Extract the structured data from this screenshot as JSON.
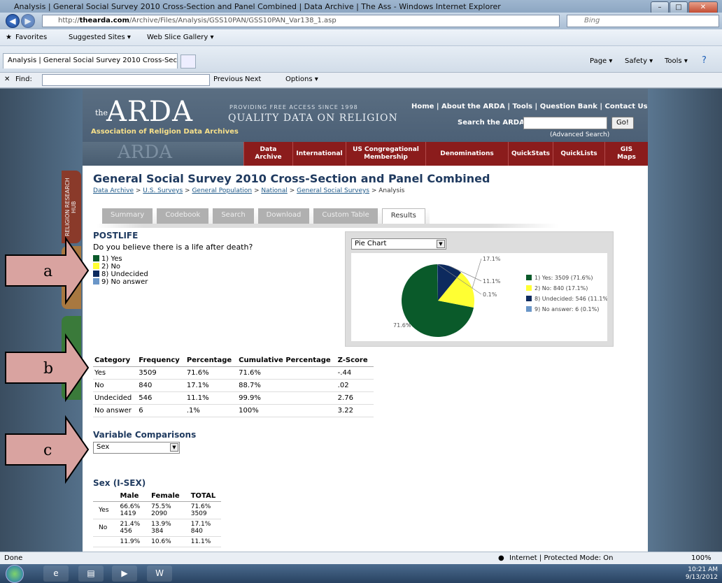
{
  "window": {
    "title": "Analysis | General Social Survey 2010 Cross-Section and Panel Combined | Data Archive | The Ass - Windows Internet Explorer",
    "url_prefix": "http://",
    "url_host": "thearda.com",
    "url_path": "/Archive/Files/Analysis/GSS10PAN/GSS10PAN_Var138_1.asp",
    "search_placeholder": "Bing",
    "favorites_label": "Favorites",
    "suggested_sites": "Suggested Sites ▾",
    "web_slice": "Web Slice Gallery ▾",
    "tab_label": "Analysis | General Social Survey 2010 Cross-Sectio...",
    "cmd_page": "Page ▾",
    "cmd_safety": "Safety ▾",
    "cmd_tools": "Tools ▾",
    "find_label": "Find:",
    "find_previous": "Previous",
    "find_next": "Next",
    "find_options": "Options ▾",
    "status_left": "Done",
    "status_zone": "Internet | Protected Mode: On",
    "zoom": "100%",
    "clock_time": "10:21 AM",
    "clock_date": "9/13/2012"
  },
  "site": {
    "logo_the": "the",
    "logo_main": "ARDA",
    "logo_sub": "Association of Religion Data Archives",
    "tagline_small": "PROVIDING FREE ACCESS SINCE 1998",
    "tagline_big": "QUALITY DATA ON RELIGION",
    "top_links": "Home | About the ARDA | Tools | Question Bank | Contact Us",
    "search_label": "Search the ARDA",
    "go_label": "Go!",
    "advanced_search": "(Advanced Search)",
    "nav": [
      "Data\nArchive",
      "International",
      "US Congregational\nMembership",
      "Denominations",
      "QuickStats",
      "QuickLists",
      "GIS\nMaps"
    ],
    "hub_label": "RELIGION RESEARCH HUB"
  },
  "page": {
    "title": "General Social Survey 2010 Cross-Section and Panel Combined",
    "crumbs": [
      "Data Archive",
      "U.S. Surveys",
      "General Population",
      "National",
      "General Social Surveys"
    ],
    "crumb_last": "Analysis",
    "tabs": [
      "Summary",
      "Codebook",
      "Search",
      "Download",
      "Custom Table",
      "Results"
    ],
    "variable": "POSTLIFE",
    "question": "Do you believe there is a life after death?",
    "legend": [
      "1) Yes",
      "2) No",
      "8) Undecided",
      "9) No answer"
    ],
    "chart_select": "Pie Chart",
    "pie_legend": [
      "1) Yes: 3509 (71.6%)",
      "2) No: 840 (17.1%)",
      "8) Undecided: 546 (11.1%)",
      "9) No answer: 6 (0.1%)"
    ],
    "pie_labels": [
      "71.6%",
      "17.1%",
      "11.1%",
      "0.1%"
    ],
    "table_headers": [
      "Category",
      "Frequency",
      "Percentage",
      "Cumulative Percentage",
      "Z-Score"
    ],
    "table_rows": [
      [
        "Yes",
        "3509",
        "71.6%",
        "71.6%",
        "-.44"
      ],
      [
        "No",
        "840",
        "17.1%",
        "88.7%",
        ".02"
      ],
      [
        "Undecided",
        "546",
        "11.1%",
        "99.9%",
        "2.76"
      ],
      [
        "No answer",
        "6",
        ".1%",
        "100%",
        "3.22"
      ]
    ],
    "var_comparisons": "Variable Comparisons",
    "comparison_select": "Sex",
    "sex_heading": "Sex (I-SEX)",
    "sex_headers": [
      "",
      "Male",
      "Female",
      "TOTAL"
    ],
    "sex_rows": [
      [
        "Yes",
        "66.6%",
        "1419",
        "75.5%",
        "2090",
        "71.6%",
        "3509"
      ],
      [
        "No",
        "21.4%",
        "456",
        "13.9%",
        "384",
        "17.1%",
        "840"
      ],
      [
        "",
        "11.9%",
        "",
        "10.6%",
        "",
        "11.1%",
        ""
      ]
    ]
  },
  "annotations": [
    "a",
    "b",
    "c"
  ],
  "colors": {
    "yes": "#0a5a2a",
    "no": "#ffff33",
    "undecided": "#0d2a5e",
    "no_answer": "#6a96c8",
    "arrow_fill": "#d9a3a0",
    "nav_red": "#8b1c1c"
  },
  "chart_data": {
    "type": "pie",
    "categories": [
      "1) Yes",
      "2) No",
      "8) Undecided",
      "9) No answer"
    ],
    "values": [
      3509,
      840,
      546,
      6
    ],
    "percentages": [
      71.6,
      17.1,
      11.1,
      0.1
    ],
    "legend_position": "right"
  }
}
